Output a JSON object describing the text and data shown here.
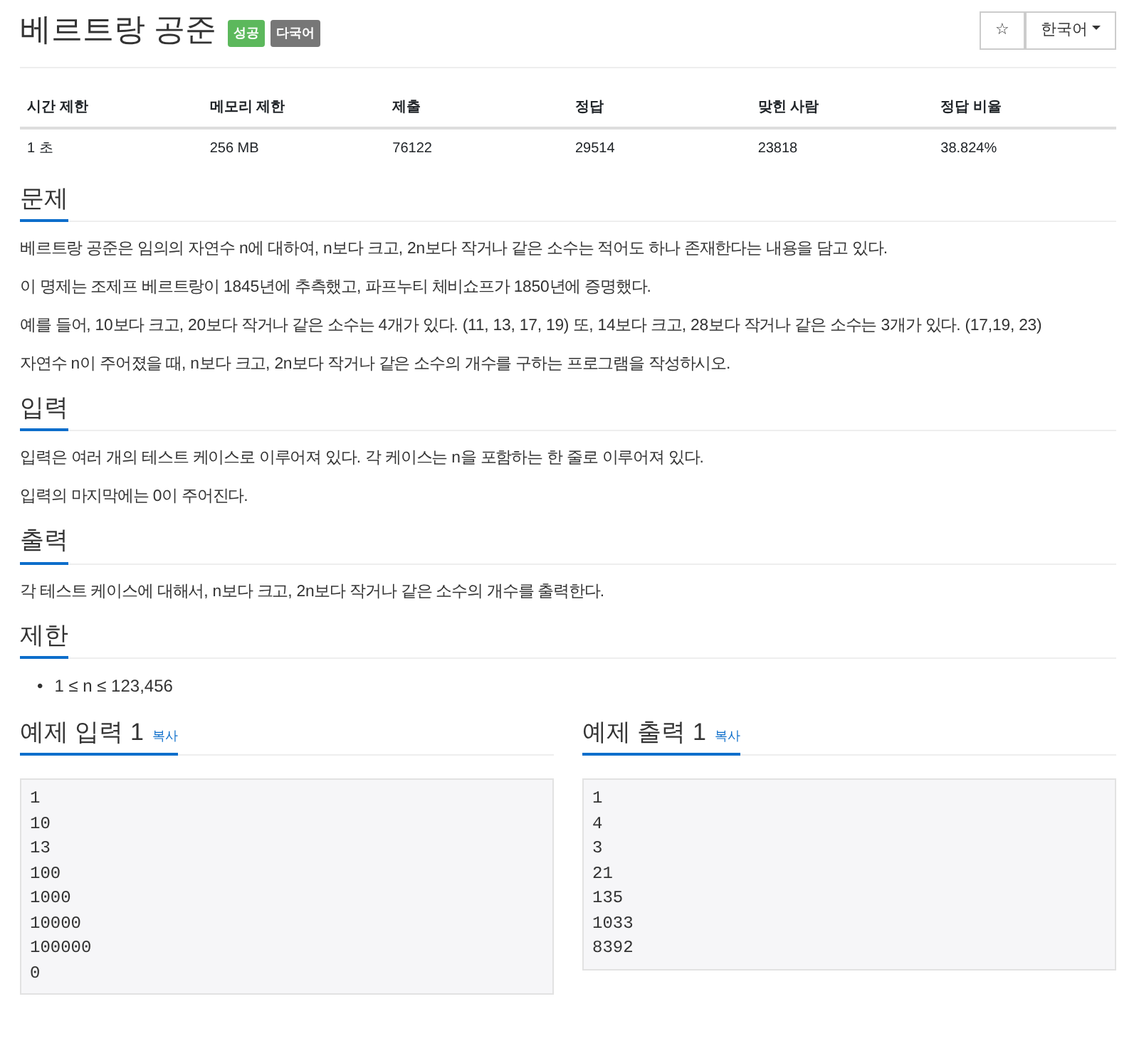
{
  "title": "베르트랑 공준",
  "badges": [
    {
      "text": "성공",
      "color": "#5cb85c"
    },
    {
      "text": "다국어",
      "color": "#777777"
    }
  ],
  "star_button": "☆",
  "language_dropdown": "한국어",
  "stats": {
    "columns": [
      "시간 제한",
      "메모리 제한",
      "제출",
      "정답",
      "맞힌 사람",
      "정답 비율"
    ],
    "values": [
      "1 초",
      "256 MB",
      "76122",
      "29514",
      "23818",
      "38.824%"
    ]
  },
  "sections": [
    {
      "kind": "paragraphs",
      "heading": "문제",
      "items": [
        "베르트랑 공준은 임의의 자연수 n에 대하여, n보다 크고, 2n보다 작거나 같은 소수는 적어도 하나 존재한다는 내용을 담고 있다.",
        "이 명제는 조제프 베르트랑이 1845년에 추측했고, 파프누티 체비쇼프가 1850년에 증명했다.",
        "예를 들어, 10보다 크고, 20보다 작거나 같은 소수는 4개가 있다. (11, 13, 17, 19) 또, 14보다 크고, 28보다 작거나 같은 소수는 3개가 있다. (17,19, 23)",
        "자연수 n이 주어졌을 때, n보다 크고, 2n보다 작거나 같은 소수의 개수를 구하는 프로그램을 작성하시오."
      ]
    },
    {
      "kind": "paragraphs",
      "heading": "입력",
      "items": [
        "입력은 여러 개의 테스트 케이스로 이루어져 있다. 각 케이스는 n을 포함하는 한 줄로 이루어져 있다.",
        "입력의 마지막에는 0이 주어진다."
      ]
    },
    {
      "kind": "paragraphs",
      "heading": "출력",
      "items": [
        "각 테스트 케이스에 대해서, n보다 크고, 2n보다 작거나 같은 소수의 개수를 출력한다."
      ]
    },
    {
      "kind": "list",
      "heading": "제한",
      "items": [
        {
          "marker": "•",
          "text": "1 ≤ n ≤ 123,456"
        }
      ]
    }
  ],
  "samples": [
    {
      "heading": "예제 입력 1",
      "copy": "복사",
      "lines": [
        "1",
        "10",
        "13",
        "100",
        "1000",
        "10000",
        "100000",
        "0"
      ]
    },
    {
      "heading": "예제 출력 1",
      "copy": "복사",
      "lines": [
        "1",
        "4",
        "3",
        "21",
        "135",
        "1033",
        "8392"
      ]
    }
  ]
}
